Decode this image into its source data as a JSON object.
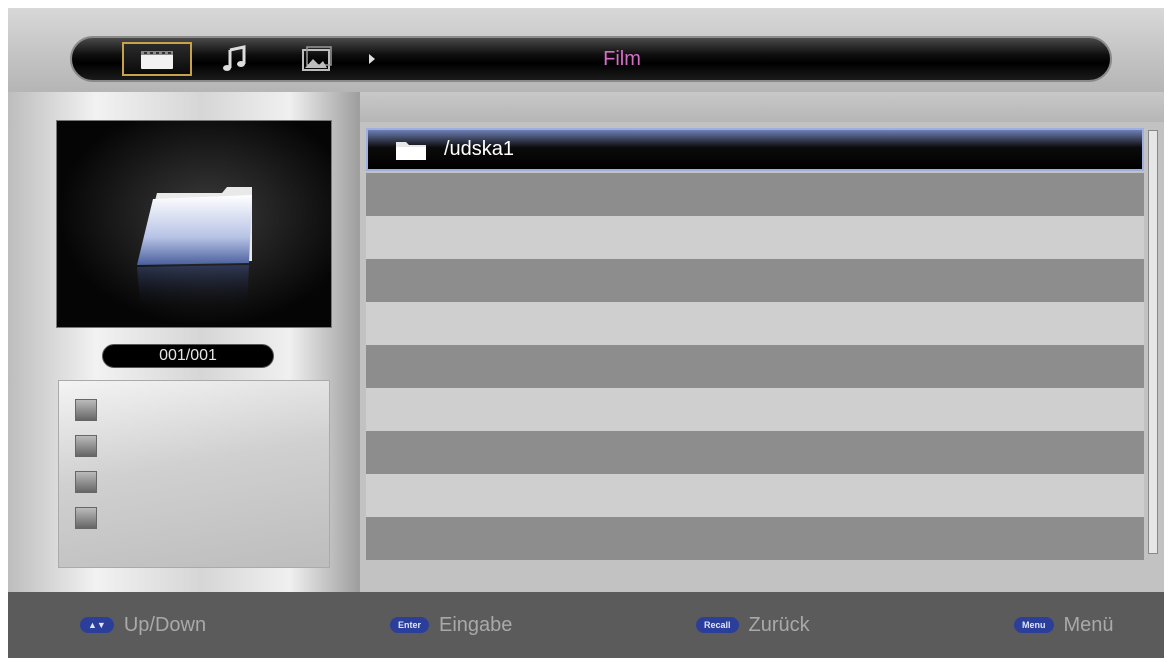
{
  "header": {
    "title": "Film",
    "tabs": [
      {
        "name": "movie",
        "icon": "film-icon",
        "active": true
      },
      {
        "name": "music",
        "icon": "music-note-icon",
        "active": false
      },
      {
        "name": "photo",
        "icon": "photo-icon",
        "active": false
      }
    ]
  },
  "preview": {
    "icon": "folder-icon",
    "counter": "001/001"
  },
  "info_icons": [
    "landscape-icon",
    "person-icon",
    "monitor-icon",
    "user-settings-icon"
  ],
  "file_list": {
    "items": [
      {
        "label": "/udska1",
        "icon": "folder-icon",
        "selected": true
      }
    ]
  },
  "footer": {
    "hints": [
      {
        "key": "▲▼",
        "label": "Up/Down"
      },
      {
        "key": "Enter",
        "label": "Eingabe"
      },
      {
        "key": "Recall",
        "label": "Zurück"
      },
      {
        "key": "Menu",
        "label": "Menü"
      }
    ]
  },
  "colors": {
    "title": "#d86dc8",
    "active_tab_border": "#c8a24a",
    "selection_border": "#9fb0e0",
    "key_pill": "#2b3e9a",
    "footer_bg": "#5b5b5b"
  }
}
